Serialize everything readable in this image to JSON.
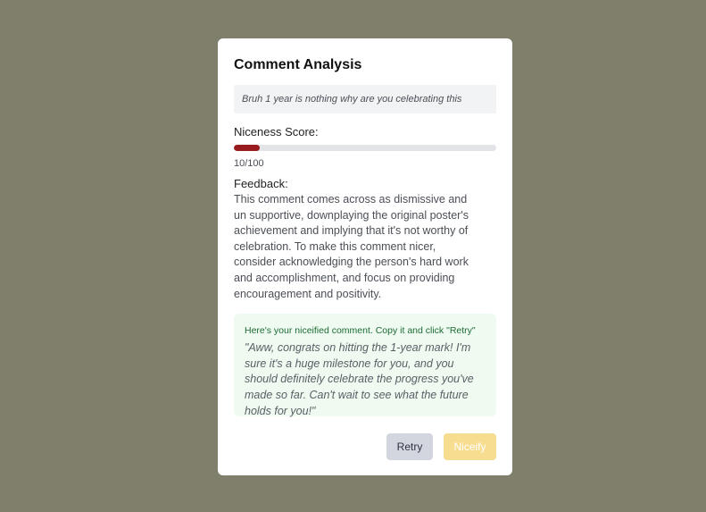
{
  "modal": {
    "title": "Comment Analysis",
    "original_comment": "Bruh 1 year is nothing why are you celebrating this",
    "score_label": "Niceness Score:",
    "score": 10,
    "score_max": 100,
    "score_text": "10/100",
    "feedback_label": "Feedback:",
    "feedback_text": "This comment comes across as dismissive and un supportive, downplaying the original poster's achievement and implying that it's not worthy of celebration. To make this comment nicer, consider acknowledging the person's hard work and accomplishment, and focus on providing encouragement and positivity.",
    "niceified_header": "Here's your niceified comment. Copy it and click \"Retry\"",
    "niceified_text": "\"Aww, congrats on hitting the 1-year mark! I'm sure it's a huge milestone for you, and you should definitely celebrate the progress you've made so far. Can't wait to see what the future holds for you!\"",
    "buttons": {
      "retry_label": "Retry",
      "niceify_label": "Niceify"
    }
  },
  "colors": {
    "backdrop": "#7f7f6c",
    "score_bar_fill": "#981b1e",
    "niceify_button": "#f6dd8f",
    "niceified_box": "#effaf1"
  }
}
